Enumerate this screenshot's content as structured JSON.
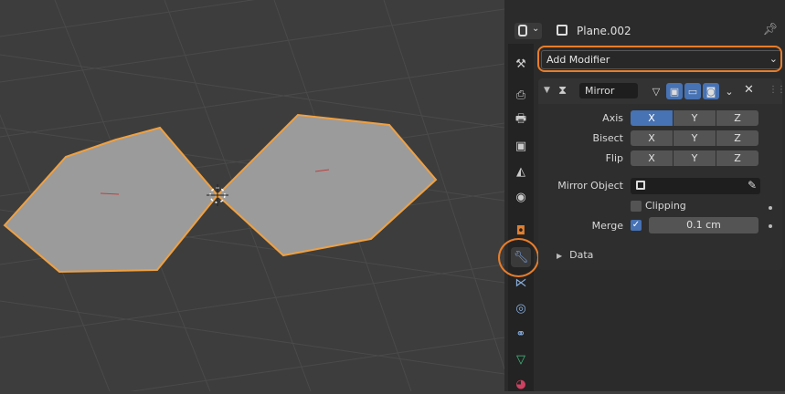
{
  "properties": {
    "object_name": "Plane.002",
    "add_modifier_label": "Add Modifier",
    "modifier": {
      "name": "Mirror",
      "axis_label": "Axis",
      "bisect_label": "Bisect",
      "flip_label": "Flip",
      "axis_options": [
        "X",
        "Y",
        "Z"
      ],
      "mirror_object_label": "Mirror Object",
      "clipping_label": "Clipping",
      "merge_label": "Merge",
      "merge_value": "0.1 cm",
      "data_label": "Data"
    }
  },
  "colors": {
    "highlight": "#e87d2a",
    "active_blue": "#4772b3"
  }
}
